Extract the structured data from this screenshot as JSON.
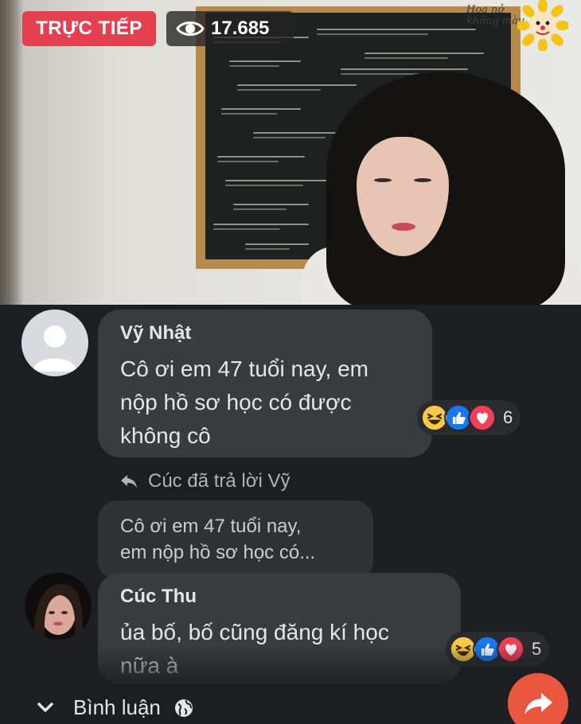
{
  "live": {
    "badge_label": "TRỰC TIẾP",
    "viewer_count": "17.685",
    "viewer_icon": "eye-icon",
    "colors": {
      "live_red": "#e4404f"
    }
  },
  "comments": [
    {
      "author": "Vỹ Nhật",
      "avatar": "default-avatar",
      "text_lines": [
        "Cô ơi em 47 tuổi nay, em",
        "nộp hồ sơ học có được",
        "không cô"
      ],
      "reactions": [
        "haha",
        "like",
        "love"
      ],
      "reaction_count": "6"
    },
    {
      "reply_indicator": "Cúc đã trả lời Vỹ",
      "quote_lines": [
        "Cô ơi em 47 tuổi nay,",
        "em nộp hồ sơ học có..."
      ],
      "author": "Cúc Thu",
      "avatar": "user-photo",
      "text_lines": [
        "ủa bố, bố cũng đăng kí học",
        "nữa à"
      ],
      "reactions": [
        "haha",
        "like",
        "love"
      ],
      "reaction_count": "5"
    }
  ],
  "footer": {
    "comments_toggle_label": "Bình luận",
    "icons": [
      "chevron-down-icon",
      "globe-icon",
      "share-icon"
    ],
    "share_color": "#e9573f"
  },
  "colors": {
    "background": "#1c1e21",
    "bubble": "#3a3b3c",
    "text": "#e4e6eb",
    "muted_text": "#b0b3b8"
  }
}
